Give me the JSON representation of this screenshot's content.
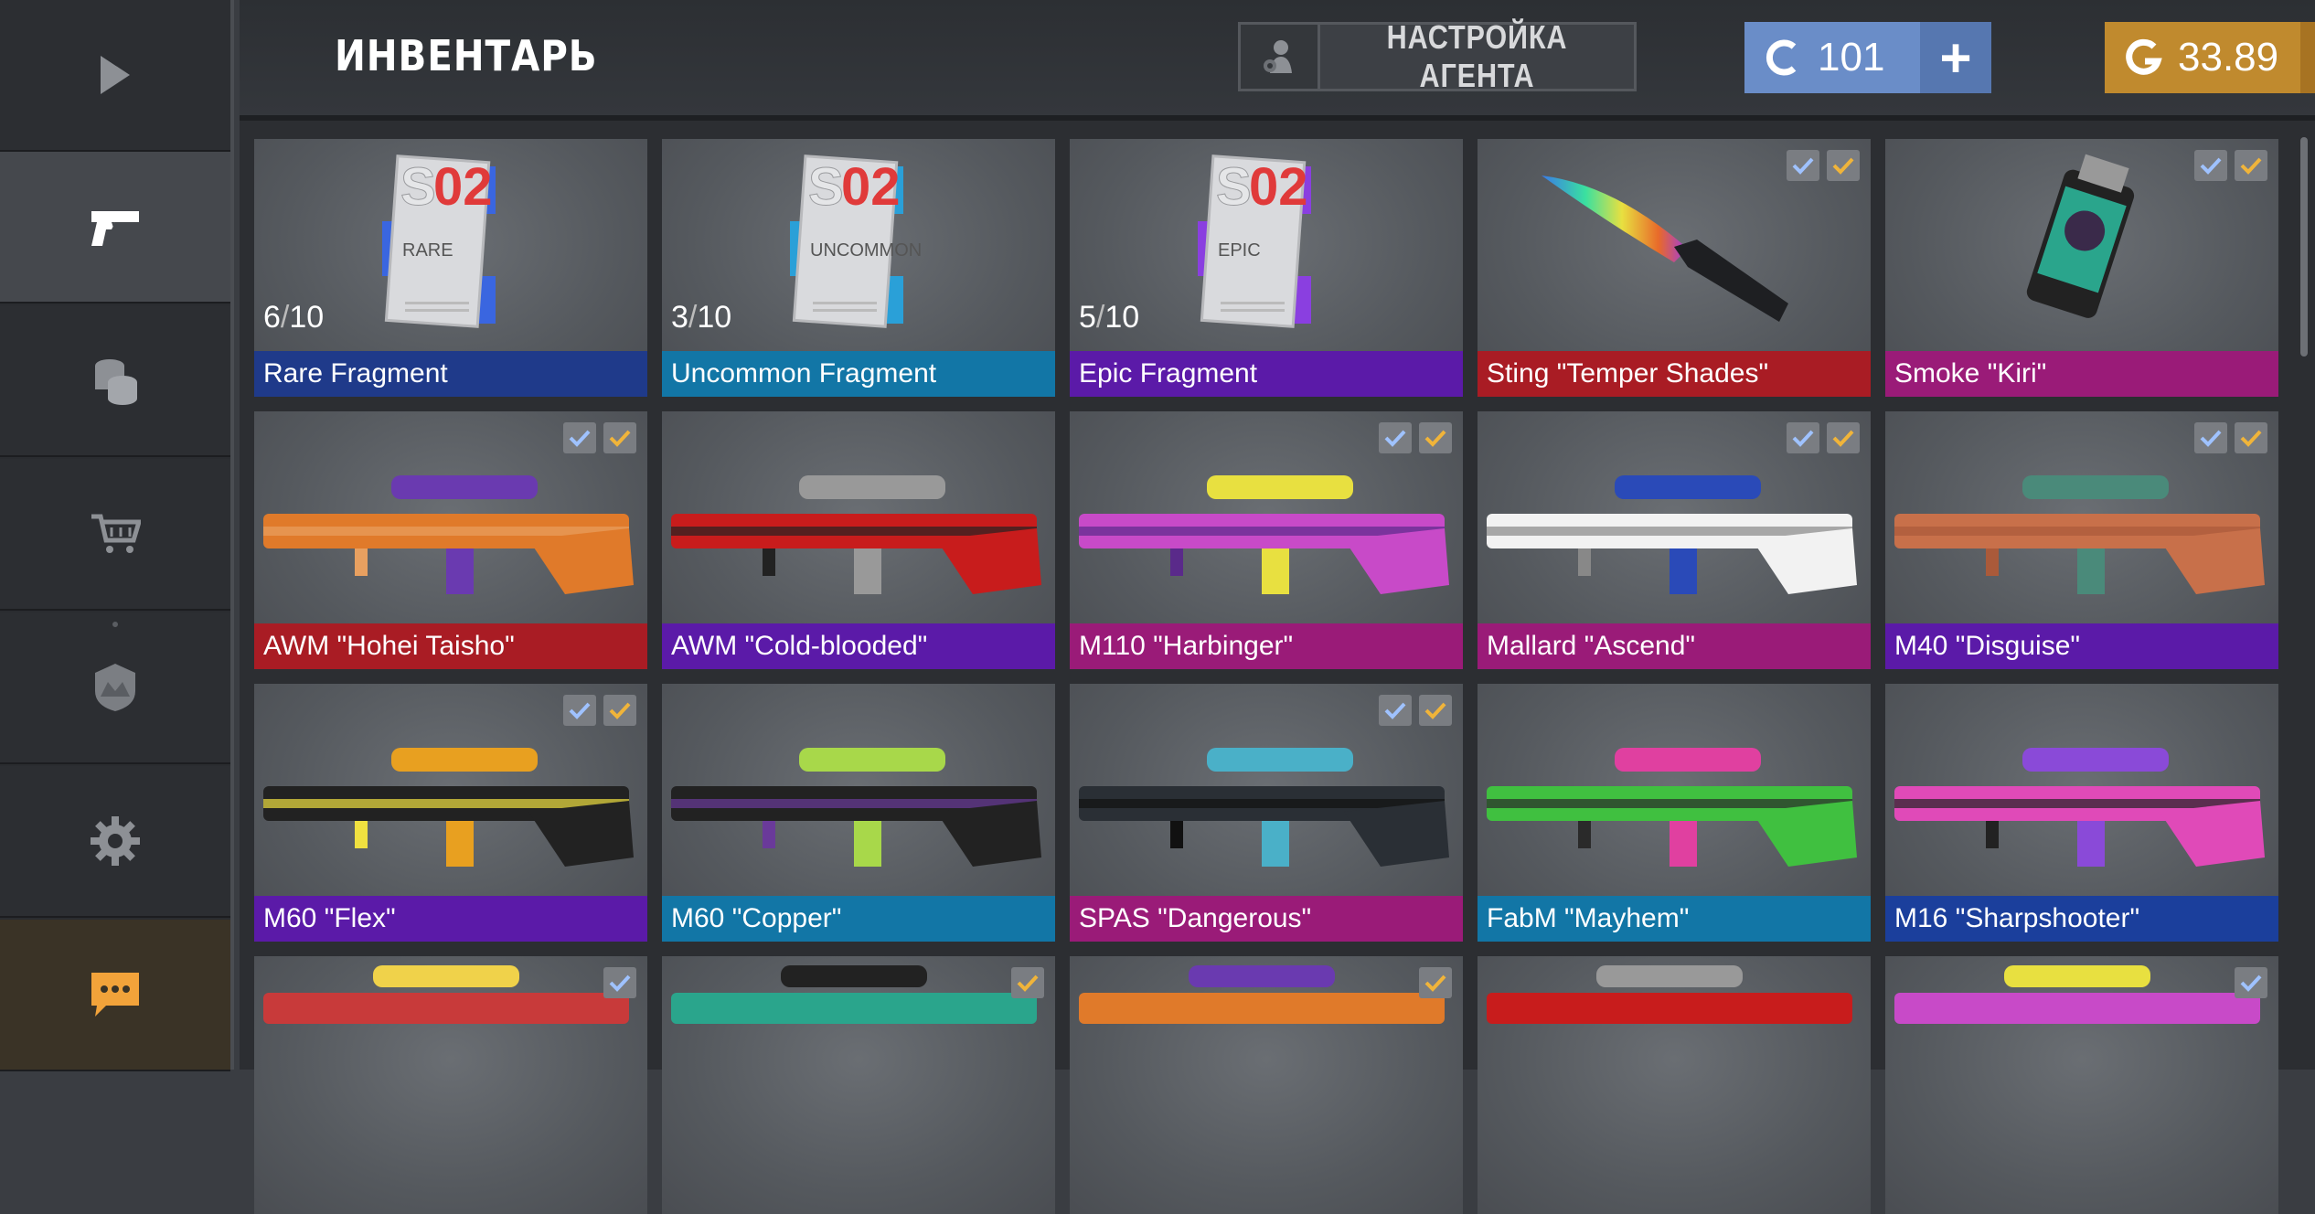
{
  "sidebar": {
    "items": [
      {
        "icon": "play-icon"
      },
      {
        "icon": "pistol-icon",
        "active": true
      },
      {
        "icon": "coins-icon"
      },
      {
        "icon": "cart-icon"
      },
      {
        "icon": "clan-shield-icon"
      },
      {
        "icon": "gear-icon"
      },
      {
        "icon": "chat-icon"
      }
    ]
  },
  "header": {
    "title": "ИНВЕНТАРЬ",
    "agent_button": "НАСТРОЙКА АГЕНТА",
    "credits": {
      "amount": "101",
      "plus": "+",
      "color": "#6a8dc8"
    },
    "gold": {
      "amount": "33.89",
      "plus": "+",
      "color": "#c08a2e"
    }
  },
  "inventory": {
    "cards": [
      {
        "name": "Rare Fragment",
        "rarity": "blue",
        "count": "6",
        "total": "10",
        "s02": "S02",
        "tier": "RARE",
        "checks": []
      },
      {
        "name": "Uncommon Fragment",
        "rarity": "teal",
        "count": "3",
        "total": "10",
        "s02": "S02",
        "tier": "UNCOMMON",
        "checks": []
      },
      {
        "name": "Epic Fragment",
        "rarity": "purple",
        "count": "5",
        "total": "10",
        "s02": "S02",
        "tier": "EPIC",
        "checks": []
      },
      {
        "name": "Sting \"Temper Shades\"",
        "rarity": "red",
        "checks": [
          "ct",
          "t"
        ]
      },
      {
        "name": "Smoke \"Kiri\"",
        "rarity": "pink",
        "checks": [
          "ct",
          "t"
        ]
      },
      {
        "name": "AWM \"Hohei Taisho\"",
        "rarity": "red",
        "checks": [
          "ct",
          "t"
        ]
      },
      {
        "name": "AWM \"Cold-blooded\"",
        "rarity": "purple",
        "checks": []
      },
      {
        "name": "M110 \"Harbinger\"",
        "rarity": "pink",
        "checks": [
          "ct",
          "t"
        ]
      },
      {
        "name": "Mallard \"Ascend\"",
        "rarity": "pink",
        "checks": [
          "ct",
          "t"
        ]
      },
      {
        "name": "M40 \"Disguise\"",
        "rarity": "purple",
        "checks": [
          "ct",
          "t"
        ]
      },
      {
        "name": "M60 \"Flex\"",
        "rarity": "purple",
        "checks": [
          "ct",
          "t"
        ]
      },
      {
        "name": "M60 \"Copper\"",
        "rarity": "teal",
        "checks": []
      },
      {
        "name": "SPAS \"Dangerous\"",
        "rarity": "pink",
        "checks": [
          "ct",
          "t"
        ]
      },
      {
        "name": "FabM \"Mayhem\"",
        "rarity": "teal",
        "checks": []
      },
      {
        "name": "M16 \"Sharpshooter\"",
        "rarity": "darkblue",
        "checks": []
      },
      {
        "name": "",
        "rarity": "none",
        "checks": [
          "ct"
        ]
      },
      {
        "name": "",
        "rarity": "none",
        "checks": [
          "t"
        ]
      },
      {
        "name": "",
        "rarity": "none",
        "checks": [
          "t"
        ]
      },
      {
        "name": "",
        "rarity": "none",
        "checks": []
      },
      {
        "name": "",
        "rarity": "none",
        "checks": [
          "ct"
        ]
      }
    ]
  },
  "colors": {
    "rarity_blue": "#1f3a8a",
    "rarity_teal": "#1276a6",
    "rarity_purple": "#5b1aa8",
    "rarity_red": "#a91c24",
    "rarity_pink": "#9a1b78",
    "check_ct": "#9fc2ff",
    "check_t": "#f0b43a"
  }
}
